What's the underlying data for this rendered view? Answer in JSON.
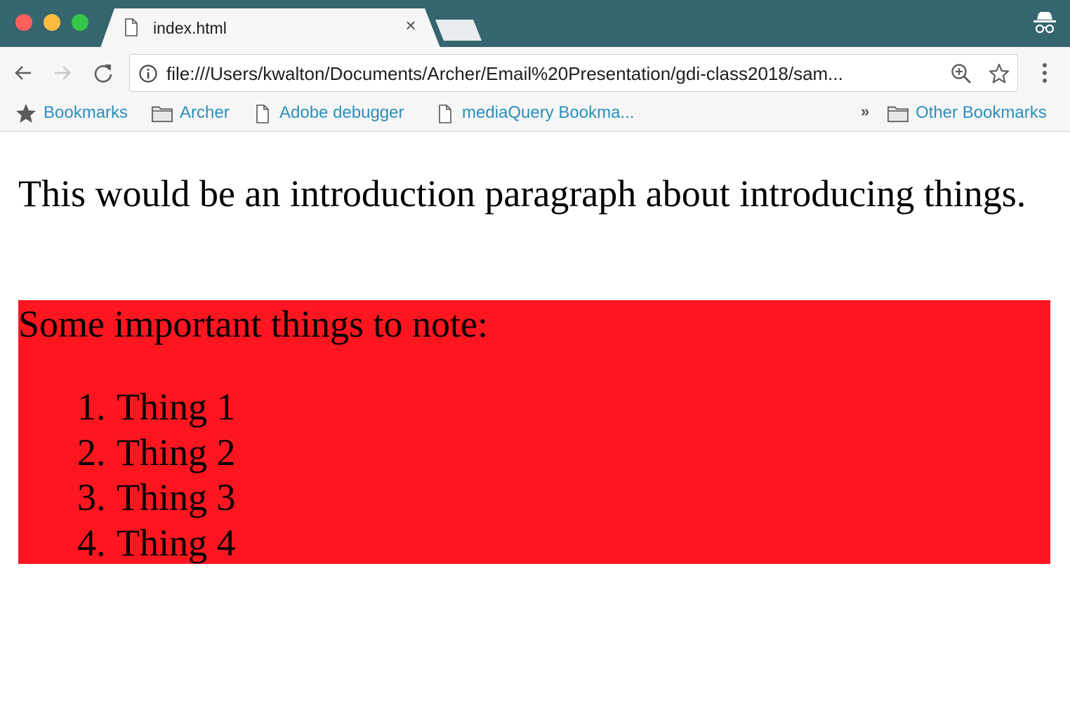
{
  "browser": {
    "tab": {
      "title": "index.html",
      "close_glyph": "×"
    },
    "toolbar": {
      "url": "file:///Users/kwalton/Documents/Archer/Email%20Presentation/gdi-class2018/sam..."
    },
    "bookmarks_bar": {
      "items": [
        {
          "label": "Bookmarks",
          "icon": "star-icon"
        },
        {
          "label": "Archer",
          "icon": "folder-icon"
        },
        {
          "label": "Adobe debugger",
          "icon": "page-icon"
        },
        {
          "label": "mediaQuery Bookma...",
          "icon": "page-icon"
        }
      ],
      "overflow_glyph": "»",
      "other": {
        "label": "Other Bookmarks",
        "icon": "folder-icon"
      }
    }
  },
  "page": {
    "intro": "This would be an introduction paragraph about introducing things.",
    "note_box": {
      "background": "#fd1620",
      "title": "Some important things to note:",
      "items": [
        {
          "num": "1.",
          "text": "Thing 1"
        },
        {
          "num": "2.",
          "text": "Thing 2"
        },
        {
          "num": "3.",
          "text": "Thing 3"
        },
        {
          "num": "4.",
          "text": "Thing 4"
        }
      ]
    }
  },
  "colors": {
    "titlebar": "#35666f",
    "link": "#2a8fbd"
  }
}
